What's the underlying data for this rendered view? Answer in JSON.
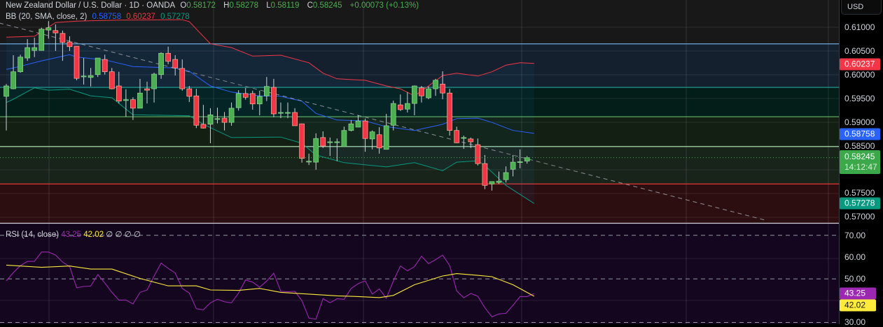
{
  "header": {
    "symbol": "New Zealand Dollar / U.S. Dollar · 1D · OANDA",
    "o_label": "O",
    "o": "0.58172",
    "h_label": "H",
    "h": "0.58278",
    "l_label": "L",
    "l": "0.58119",
    "c_label": "C",
    "c": "0.58245",
    "change": "+0.00073 (+0.13%)"
  },
  "bb_legend": {
    "label": "BB (20, SMA, close, 2)",
    "basis": "0.58758",
    "upper": "0.60237",
    "lower": "0.57278"
  },
  "rsi_legend": {
    "label": "RSI (14, close)",
    "rsi": "43.25",
    "ma": "42.02",
    "extras": [
      "∅",
      "∅",
      "∅",
      "∅"
    ]
  },
  "axis": {
    "currency": "USD",
    "price_ticks": [
      "0.61000",
      "0.60500",
      "0.60000",
      "0.59500",
      "0.59000",
      "0.58500",
      "0.57500",
      "0.57000"
    ],
    "rsi_ticks": [
      "70.00",
      "60.00",
      "50.00",
      "30.00"
    ],
    "badges": {
      "upper": "0.60237",
      "basis": "0.58758",
      "last": "0.58245",
      "countdown": "14:12:47",
      "lower": "0.57278",
      "rsi": "43.25",
      "rsi_ma": "42.02"
    }
  },
  "colors": {
    "up": "#4caf50",
    "down": "#f23645",
    "upper": "#f23645",
    "basis": "#2962ff",
    "lower": "#089981",
    "rsi": "#9c27b0",
    "rsi_ma": "#ffeb3b"
  },
  "chart_data": {
    "type": "candlestick",
    "price_range": [
      0.5685,
      0.6158
    ],
    "candles": [
      [
        0.5954,
        0.598,
        0.5882,
        0.5976
      ],
      [
        0.597,
        0.6041,
        0.5969,
        0.6006
      ],
      [
        0.6006,
        0.6042,
        0.6004,
        0.6037
      ],
      [
        0.6035,
        0.6075,
        0.6029,
        0.6057
      ],
      [
        0.6051,
        0.6078,
        0.6037,
        0.6057
      ],
      [
        0.6051,
        0.6099,
        0.6051,
        0.6096
      ],
      [
        0.6094,
        0.6113,
        0.6076,
        0.6099
      ],
      [
        0.6093,
        0.6106,
        0.605,
        0.6088
      ],
      [
        0.6087,
        0.6093,
        0.6029,
        0.6068
      ],
      [
        0.6069,
        0.6081,
        0.605,
        0.6059
      ],
      [
        0.606,
        0.606,
        0.5988,
        0.5992
      ],
      [
        0.5996,
        0.6035,
        0.5979,
        0.5997
      ],
      [
        0.5994,
        0.6014,
        0.5975,
        0.5998
      ],
      [
        0.6,
        0.6035,
        0.5995,
        0.6035
      ],
      [
        0.6032,
        0.6042,
        0.6,
        0.6006
      ],
      [
        0.6006,
        0.6014,
        0.5969,
        0.597
      ],
      [
        0.5976,
        0.6006,
        0.5939,
        0.5944
      ],
      [
        0.5946,
        0.5969,
        0.5911,
        0.5947
      ],
      [
        0.5947,
        0.5952,
        0.5904,
        0.5929
      ],
      [
        0.5929,
        0.5991,
        0.5929,
        0.5961
      ],
      [
        0.597,
        0.5985,
        0.5939,
        0.5967
      ],
      [
        0.597,
        0.6004,
        0.5941,
        0.6001
      ],
      [
        0.6,
        0.6047,
        0.5991,
        0.6045
      ],
      [
        0.6045,
        0.6059,
        0.6022,
        0.6028
      ],
      [
        0.6032,
        0.6041,
        0.5998,
        0.6014
      ],
      [
        0.6013,
        0.6032,
        0.5966,
        0.597
      ],
      [
        0.597,
        0.5976,
        0.5942,
        0.5954
      ],
      [
        0.5955,
        0.597,
        0.5887,
        0.5893
      ],
      [
        0.5895,
        0.5936,
        0.5886,
        0.5887
      ],
      [
        0.5895,
        0.5929,
        0.5855,
        0.5915
      ],
      [
        0.5906,
        0.593,
        0.5897,
        0.5907
      ],
      [
        0.5908,
        0.5921,
        0.5882,
        0.5899
      ],
      [
        0.5899,
        0.5941,
        0.5892,
        0.5929
      ],
      [
        0.593,
        0.5967,
        0.5924,
        0.596
      ],
      [
        0.596,
        0.5972,
        0.5947,
        0.5952
      ],
      [
        0.596,
        0.5966,
        0.5926,
        0.5938
      ],
      [
        0.5938,
        0.5966,
        0.5914,
        0.5954
      ],
      [
        0.5955,
        0.5995,
        0.5944,
        0.5975
      ],
      [
        0.5973,
        0.5991,
        0.591,
        0.5917
      ],
      [
        0.5919,
        0.5941,
        0.5908,
        0.592
      ],
      [
        0.5919,
        0.5941,
        0.5908,
        0.592
      ],
      [
        0.592,
        0.5929,
        0.5892,
        0.5892
      ],
      [
        0.5896,
        0.5896,
        0.5814,
        0.5823
      ],
      [
        0.5816,
        0.5833,
        0.5809,
        0.5817
      ],
      [
        0.5815,
        0.5876,
        0.5799,
        0.5865
      ],
      [
        0.5867,
        0.588,
        0.5845,
        0.5849
      ],
      [
        0.5857,
        0.5867,
        0.5828,
        0.5858
      ],
      [
        0.5857,
        0.5865,
        0.5817,
        0.5858
      ],
      [
        0.5848,
        0.589,
        0.5848,
        0.5882
      ],
      [
        0.5882,
        0.5904,
        0.588,
        0.5896
      ],
      [
        0.5889,
        0.5914,
        0.5889,
        0.5902
      ],
      [
        0.5902,
        0.5907,
        0.5837,
        0.5865
      ],
      [
        0.5864,
        0.5882,
        0.5842,
        0.5879
      ],
      [
        0.5873,
        0.5889,
        0.5833,
        0.5845
      ],
      [
        0.5842,
        0.5917,
        0.5842,
        0.5892
      ],
      [
        0.5893,
        0.5945,
        0.5882,
        0.5939
      ],
      [
        0.5936,
        0.5958,
        0.5923,
        0.5926
      ],
      [
        0.5927,
        0.5963,
        0.592,
        0.5939
      ],
      [
        0.5939,
        0.5977,
        0.5914,
        0.5976
      ],
      [
        0.5972,
        0.5976,
        0.5941,
        0.5955
      ],
      [
        0.5951,
        0.5975,
        0.5948,
        0.597
      ],
      [
        0.597,
        0.5991,
        0.5955,
        0.5988
      ],
      [
        0.598,
        0.6007,
        0.5948,
        0.5961
      ],
      [
        0.5961,
        0.597,
        0.5871,
        0.5882
      ],
      [
        0.5882,
        0.589,
        0.5855,
        0.5856
      ],
      [
        0.5866,
        0.5871,
        0.5843,
        0.5867
      ],
      [
        0.5864,
        0.5867,
        0.5845,
        0.5858
      ],
      [
        0.5852,
        0.5865,
        0.5808,
        0.5812
      ],
      [
        0.5812,
        0.583,
        0.5758,
        0.5766
      ],
      [
        0.5769,
        0.5774,
        0.5755,
        0.5774
      ],
      [
        0.5772,
        0.5795,
        0.5769,
        0.5775
      ],
      [
        0.5778,
        0.5806,
        0.5772,
        0.5793
      ],
      [
        0.58,
        0.583,
        0.5785,
        0.5815
      ],
      [
        0.5815,
        0.5842,
        0.5802,
        0.5816
      ],
      [
        0.58172,
        0.58278,
        0.58119,
        0.58245
      ]
    ],
    "bb_upper": [
      [
        0,
        0.6079
      ],
      [
        4,
        0.6081
      ],
      [
        7,
        0.611
      ],
      [
        10,
        0.6113
      ],
      [
        16,
        0.6115
      ],
      [
        25,
        0.6116
      ],
      [
        26,
        0.6112
      ],
      [
        29,
        0.6065
      ],
      [
        32,
        0.6057
      ],
      [
        35,
        0.6039
      ],
      [
        39,
        0.6041
      ],
      [
        43,
        0.6025
      ],
      [
        45,
        0.6003
      ],
      [
        47,
        0.5991
      ],
      [
        51,
        0.5988
      ],
      [
        54,
        0.5976
      ],
      [
        56,
        0.597
      ],
      [
        58,
        0.5955
      ],
      [
        60,
        0.5976
      ],
      [
        62,
        0.5998
      ],
      [
        64,
        0.6003
      ],
      [
        67,
        0.5997
      ],
      [
        69,
        0.6006
      ],
      [
        71,
        0.602
      ],
      [
        73,
        0.6025
      ],
      [
        75,
        0.60237
      ]
    ],
    "bb_basis": [
      [
        0,
        0.6011
      ],
      [
        1,
        0.6014
      ],
      [
        5,
        0.6029
      ],
      [
        9,
        0.6042
      ],
      [
        10,
        0.6037
      ],
      [
        14,
        0.6031
      ],
      [
        18,
        0.6017
      ],
      [
        24,
        0.6014
      ],
      [
        26,
        0.6007
      ],
      [
        29,
        0.5976
      ],
      [
        32,
        0.5963
      ],
      [
        36,
        0.5955
      ],
      [
        39,
        0.5954
      ],
      [
        42,
        0.5944
      ],
      [
        44,
        0.5918
      ],
      [
        47,
        0.5904
      ],
      [
        51,
        0.5902
      ],
      [
        54,
        0.589
      ],
      [
        58,
        0.5882
      ],
      [
        62,
        0.5895
      ],
      [
        64,
        0.5907
      ],
      [
        67,
        0.5908
      ],
      [
        69,
        0.5899
      ],
      [
        72,
        0.5882
      ],
      [
        75,
        0.58758
      ]
    ],
    "bb_lower": [
      [
        0,
        0.5941
      ],
      [
        1,
        0.5948
      ],
      [
        4,
        0.5972
      ],
      [
        6,
        0.5967
      ],
      [
        9,
        0.5969
      ],
      [
        12,
        0.5955
      ],
      [
        15,
        0.5951
      ],
      [
        18,
        0.5915
      ],
      [
        26,
        0.5913
      ],
      [
        28,
        0.5895
      ],
      [
        32,
        0.5867
      ],
      [
        39,
        0.5868
      ],
      [
        42,
        0.5855
      ],
      [
        44,
        0.583
      ],
      [
        48,
        0.5814
      ],
      [
        54,
        0.5805
      ],
      [
        58,
        0.5814
      ],
      [
        62,
        0.5797
      ],
      [
        64,
        0.5815
      ],
      [
        67,
        0.5818
      ],
      [
        68,
        0.5808
      ],
      [
        71,
        0.5766
      ],
      [
        75,
        0.57278
      ]
    ],
    "levels": [
      {
        "price": 0.6065,
        "color": "#6fa8dc",
        "fill": "#14202e"
      },
      {
        "price": 0.5973,
        "color": "#26a69a",
        "fill": "#031d19"
      },
      {
        "price": 0.5911,
        "color": "#66bb6a",
        "fill": "#121f12"
      },
      {
        "price": 0.5848,
        "color": "#a5d6a7",
        "fill": "#18231a"
      },
      {
        "price": 0.5769,
        "color": "#e53935",
        "fill": "#2c0d10"
      }
    ],
    "trendline": {
      "from": [
        -1,
        0.6109
      ],
      "to": [
        108,
        0.5692
      ]
    },
    "rsi": [
      49.1,
      52.9,
      56.1,
      58,
      58,
      62.3,
      62.3,
      60.9,
      57.7,
      55.6,
      45.9,
      46.5,
      46.7,
      52,
      48.1,
      43.8,
      40.3,
      40.3,
      38.5,
      43.8,
      44.9,
      51.3,
      57.2,
      54.8,
      52.7,
      45.6,
      43.5,
      36.3,
      35.8,
      39,
      40.6,
      39.5,
      39,
      43.5,
      49.5,
      48.5,
      46.2,
      49,
      52.6,
      44.3,
      44.1,
      44.3,
      40,
      32,
      31.5,
      40.9,
      39,
      40.9,
      40.6,
      45.6,
      47.8,
      49.1,
      43,
      45.4,
      41.1,
      49.1,
      55.9,
      53.7,
      55.6,
      60.4,
      57,
      58.8,
      60.9,
      56.1,
      44.5,
      41.3,
      43.3,
      42,
      36.8,
      32.6,
      33.9,
      34.2,
      37.9,
      41.9,
      41.9,
      43.25
    ],
    "rsi_ma": [
      [
        0,
        56.3
      ],
      [
        5,
        55.3
      ],
      [
        9,
        55.9
      ],
      [
        12,
        54.5
      ],
      [
        15,
        54.5
      ],
      [
        19,
        50.2
      ],
      [
        23,
        46.8
      ],
      [
        27,
        46.8
      ],
      [
        29,
        44.9
      ],
      [
        33,
        44.7
      ],
      [
        36,
        45.6
      ],
      [
        39,
        43.8
      ],
      [
        43,
        43
      ],
      [
        47,
        42.2
      ],
      [
        50,
        41.9
      ],
      [
        53,
        41.4
      ],
      [
        55,
        42.4
      ],
      [
        58,
        47.3
      ],
      [
        62,
        51.3
      ],
      [
        64,
        52.4
      ],
      [
        67,
        51.6
      ],
      [
        69,
        51
      ],
      [
        72,
        47.3
      ],
      [
        75,
        42.02
      ]
    ],
    "rsi_range": [
      25,
      75
    ],
    "rsi_levels": [
      70,
      50,
      30
    ]
  }
}
